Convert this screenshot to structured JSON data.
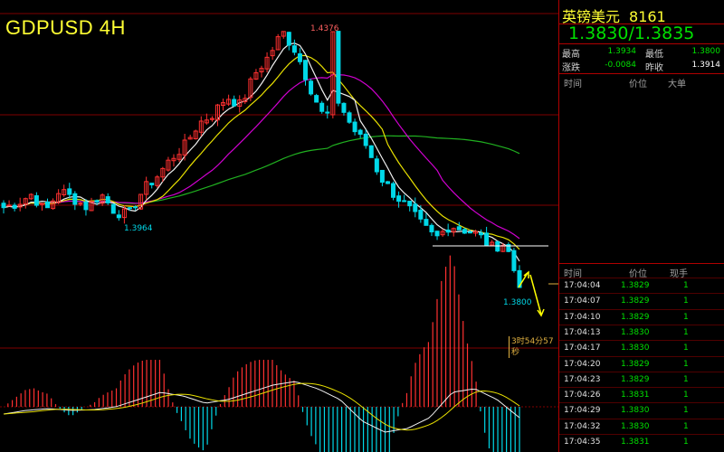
{
  "chart": {
    "title": "GDPUSD 4H",
    "high_label": "1.4376",
    "low_label_left": "1.3964",
    "low_label_right": "1.3800",
    "countdown": "3时54分57秒"
  },
  "panel": {
    "name": "英镑美元",
    "code": "8161",
    "quote": "1.3830/1.3835",
    "stats": {
      "high_label": "最高",
      "high_value": "1.3934",
      "low_label": "最低",
      "low_value": "1.3800",
      "change_label": "涨跌",
      "change_value": "-0.0084",
      "prev_label": "昨收",
      "prev_value": "1.3914"
    },
    "order_headers": {
      "time": "时间",
      "price": "价位",
      "size": "大单"
    },
    "tick_headers": {
      "time": "时间",
      "price": "价位",
      "size": "现手"
    },
    "ticks": [
      {
        "time": "17:04:04",
        "price": "1.3829",
        "vol": "1"
      },
      {
        "time": "17:04:07",
        "price": "1.3829",
        "vol": "1"
      },
      {
        "time": "17:04:10",
        "price": "1.3829",
        "vol": "1"
      },
      {
        "time": "17:04:13",
        "price": "1.3830",
        "vol": "1"
      },
      {
        "time": "17:04:17",
        "price": "1.3830",
        "vol": "1"
      },
      {
        "time": "17:04:20",
        "price": "1.3829",
        "vol": "1"
      },
      {
        "time": "17:04:23",
        "price": "1.3829",
        "vol": "1"
      },
      {
        "time": "17:04:26",
        "price": "1.3831",
        "vol": "1"
      },
      {
        "time": "17:04:29",
        "price": "1.3830",
        "vol": "1"
      },
      {
        "time": "17:04:32",
        "price": "1.3830",
        "vol": "1"
      },
      {
        "time": "17:04:35",
        "price": "1.3831",
        "vol": "1"
      }
    ]
  },
  "colors": {
    "up": "#ff3030",
    "down": "#00d8e8",
    "ma_white": "#f0f0f0",
    "ma_yellow": "#e8e000",
    "ma_magenta": "#d000d0",
    "ma_green": "#20b020",
    "grid": "#800000",
    "arrow": "#ffff00"
  },
  "chart_data": {
    "type": "candlestick",
    "price_anchors": [
      1.398,
      1.399,
      1.401,
      1.397,
      1.402,
      1.4,
      1.398,
      1.401,
      1.397,
      1.3964,
      1.402,
      1.405,
      1.409,
      1.412,
      1.417,
      1.419,
      1.423,
      1.421,
      1.428,
      1.432,
      1.4376,
      1.433,
      1.425,
      1.418,
      1.422,
      1.416,
      1.412,
      1.405,
      1.401,
      1.398,
      1.394,
      1.391,
      1.394,
      1.393,
      1.392,
      1.389,
      1.39,
      1.38
    ],
    "macd_anchors": [
      -0.002,
      -0.001,
      -0.0005,
      -0.001,
      -0.0008,
      0.0,
      0.002,
      0.004,
      0.003,
      0.001,
      0.002,
      0.004,
      0.006,
      0.007,
      0.005,
      0.002,
      -0.004,
      -0.007,
      -0.006,
      -0.003,
      0.004,
      0.005,
      0.002,
      -0.003
    ]
  }
}
